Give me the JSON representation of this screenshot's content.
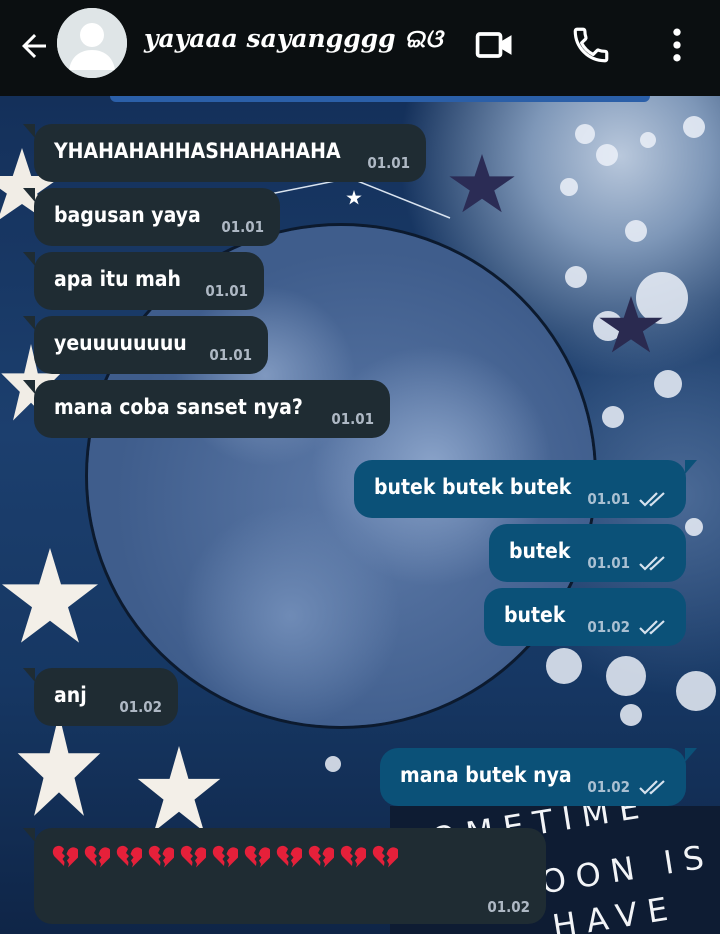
{
  "header": {
    "contact_name": "yayaaa sayangggg ଇଓ",
    "icons": [
      "back-arrow-icon",
      "avatar-placeholder-icon",
      "video-call-icon",
      "voice-call-icon",
      "more-options-icon"
    ]
  },
  "colors": {
    "header_bg": "#0b0f11",
    "incoming_bubble": "#1f2c33",
    "outgoing_bubble": "#0b5178",
    "tick_color": "#d6e2ee"
  },
  "messages": [
    {
      "direction": "incoming",
      "text": "YHAHAHAHHASHAHAHAHA",
      "time": "01.01"
    },
    {
      "direction": "incoming",
      "text": "bagusan yaya",
      "time": "01.01"
    },
    {
      "direction": "incoming",
      "text": "apa itu mah",
      "time": "01.01"
    },
    {
      "direction": "incoming",
      "text": "yeuuuuuuuu",
      "time": "01.01"
    },
    {
      "direction": "incoming",
      "text": "mana coba sanset nya?",
      "time": "01.01"
    },
    {
      "direction": "outgoing",
      "text": "butek butek butek",
      "time": "01.01",
      "status": "read"
    },
    {
      "direction": "outgoing",
      "text": "butek",
      "time": "01.01",
      "status": "read"
    },
    {
      "direction": "outgoing",
      "text": "butek",
      "time": "01.02",
      "status": "read"
    },
    {
      "direction": "incoming",
      "text": "anj",
      "time": "01.02"
    },
    {
      "direction": "outgoing",
      "text": "mana butek nya",
      "time": "01.02",
      "status": "read"
    },
    {
      "direction": "incoming",
      "text": "💔💔💔💔💔💔💔💔💔💔💔",
      "emoji": "broken-heart",
      "emoji_count": 11,
      "time": "01.02"
    }
  ],
  "wallpaper": {
    "sign_lines": [
      "SOMETIME",
      "OON IS",
      "HAVE"
    ]
  }
}
